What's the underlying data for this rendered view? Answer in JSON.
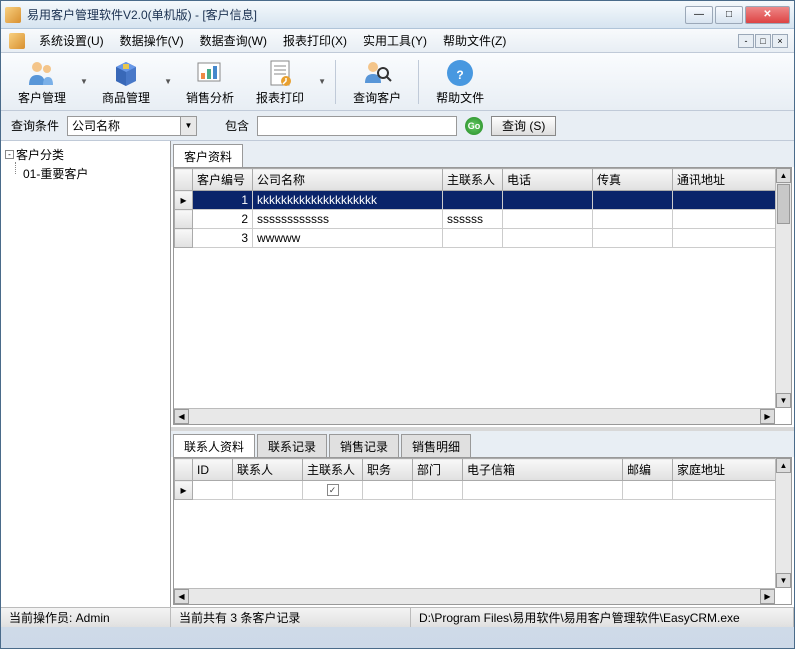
{
  "window": {
    "title": "易用客户管理软件V2.0(单机版) - [客户信息]"
  },
  "menu": {
    "items": [
      "系统设置(U)",
      "数据操作(V)",
      "数据查询(W)",
      "报表打印(X)",
      "实用工具(Y)",
      "帮助文件(Z)"
    ]
  },
  "toolbar": {
    "buttons": [
      {
        "label": "客户管理"
      },
      {
        "label": "商品管理"
      },
      {
        "label": "销售分析"
      },
      {
        "label": "报表打印"
      },
      {
        "label": "查询客户"
      },
      {
        "label": "帮助文件"
      }
    ]
  },
  "search": {
    "label": "查询条件",
    "field_value": "公司名称",
    "contain_label": "包含",
    "input_value": "",
    "button_label": "查询 (S)"
  },
  "tree": {
    "root": "客户分类",
    "children": [
      "01-重要客户"
    ]
  },
  "customer_tab": "客户资料",
  "grid1": {
    "headers": [
      "客户编号",
      "公司名称",
      "主联系人",
      "电话",
      "传真",
      "通讯地址"
    ],
    "rows": [
      {
        "id": "1",
        "company": "kkkkkkkkkkkkkkkkkkkk",
        "contact": "",
        "phone": "",
        "fax": "",
        "addr": ""
      },
      {
        "id": "2",
        "company": "ssssssssssss",
        "contact": "ssssss",
        "phone": "",
        "fax": "",
        "addr": ""
      },
      {
        "id": "3",
        "company": "wwwww",
        "contact": "",
        "phone": "",
        "fax": "",
        "addr": ""
      }
    ]
  },
  "bottom_tabs": [
    "联系人资料",
    "联系记录",
    "销售记录",
    "销售明细"
  ],
  "grid2": {
    "headers": [
      "ID",
      "联系人",
      "主联系人",
      "职务",
      "部门",
      "电子信箱",
      "邮编",
      "家庭地址"
    ]
  },
  "status": {
    "user": "当前操作员: Admin",
    "count": "当前共有 3 条客户记录",
    "path": "D:\\Program Files\\易用软件\\易用客户管理软件\\EasyCRM.exe"
  }
}
